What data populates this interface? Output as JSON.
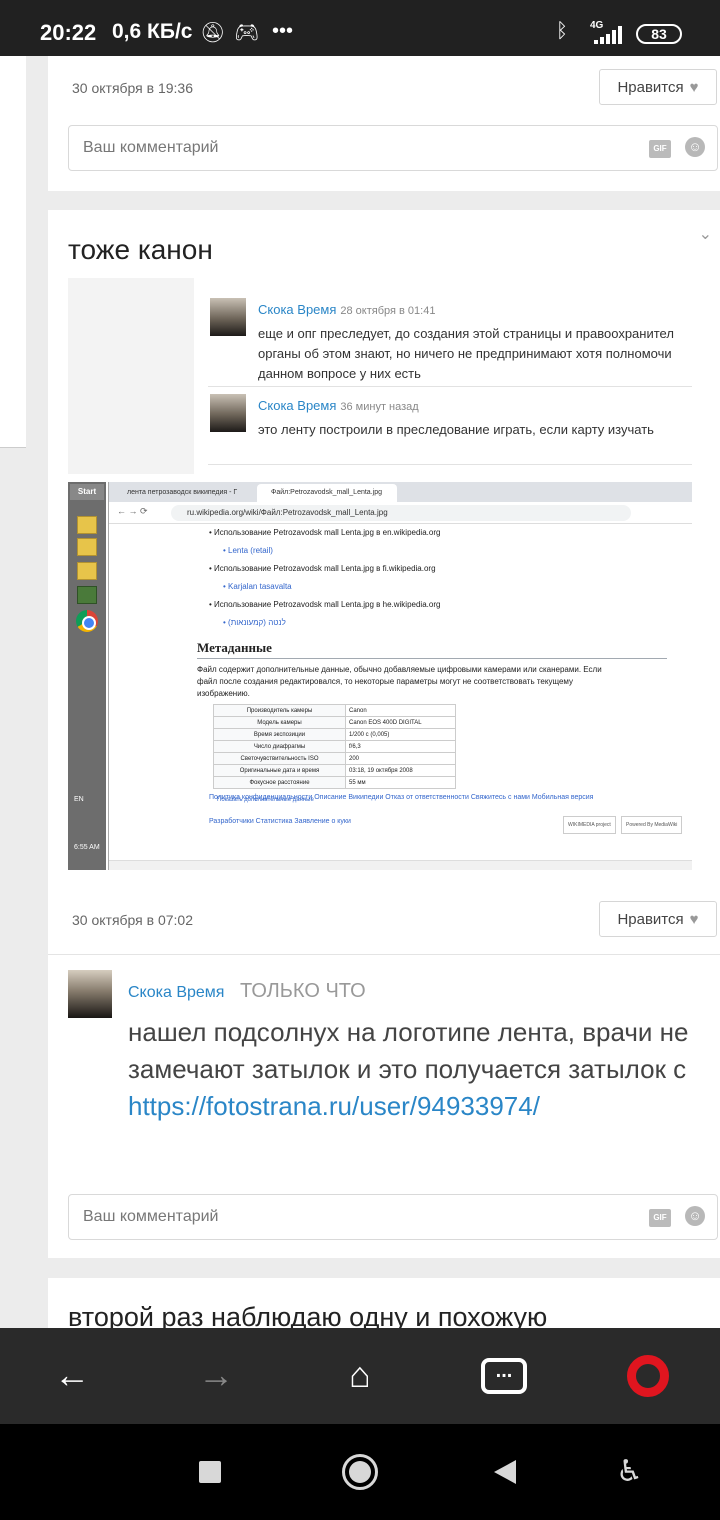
{
  "status_bar": {
    "time": "20:22",
    "speed": "0,6 КБ/с",
    "network": "4G",
    "battery": "83"
  },
  "post1": {
    "date": "30 октября в 19:36",
    "like_label": "Нравится",
    "comment_placeholder": "Ваш комментарий",
    "gif_label": "GIF"
  },
  "post2": {
    "title": "тоже канон",
    "date": "30 октября в 07:02",
    "like_label": "Нравится",
    "embedded": {
      "comments": [
        {
          "name": "Скока Время",
          "time": "28 октября в 01:41",
          "lines": [
            "еще и опг преследует, до создания этой страницы и правоохранител",
            "органы об этом знают, но ничего не предпринимают хотя полномочи",
            "данном вопросе у них есть"
          ]
        },
        {
          "name": "Скока Время",
          "time": "36 минут назад",
          "lines": [
            "это ленту построили в преследование играть, если карту изучать"
          ]
        }
      ],
      "browser": {
        "tab1": "лента петрозаводск википедия - Г",
        "tab2": "Файл:Petrozavodsk_mall_Lenta.jpg",
        "url": "ru.wikipedia.org/wiki/Файл:Petrozavodsk_mall_Lenta.jpg",
        "usage": [
          {
            "text": "Использование Petrozavodsk mall Lenta.jpg в en.wikipedia.org",
            "link": "Lenta (retail)"
          },
          {
            "text": "Использование Petrozavodsk mall Lenta.jpg в fi.wikipedia.org",
            "link": "Karjalan tasavalta"
          },
          {
            "text": "Использование Petrozavodsk mall Lenta.jpg в he.wikipedia.org",
            "link": "לנטה (קמעונאות)"
          }
        ],
        "metadata_heading": "Метаданные",
        "metadata_text": [
          "Файл содержит дополнительные данные, обычно добавляемые цифровыми камерами или сканерами. Если",
          "файл после создания редактировался, то некоторые параметры могут не соответствовать текущему",
          "изображению."
        ],
        "metadata_rows": [
          {
            "k": "Производитель камеры",
            "v": "Canon"
          },
          {
            "k": "Модель камеры",
            "v": "Canon EOS 400D DIGITAL"
          },
          {
            "k": "Время экспозиции",
            "v": "1/200 с (0,005)"
          },
          {
            "k": "Число диафрагмы",
            "v": "f/6,3"
          },
          {
            "k": "Светочувствительность ISO",
            "v": "200"
          },
          {
            "k": "Оригинальные дата и время",
            "v": "03:18, 19 октября 2008"
          },
          {
            "k": "Фокусное расстояние",
            "v": "55 мм"
          }
        ],
        "show_more": "Показать дополнительные данные",
        "footer_row1": "Политика конфиденциальности    Описание Википедии    Отказ от ответственности    Свяжитесь с нами    Мобильная версия",
        "footer_row2": "Разработчики    Статистика    Заявление о куки",
        "badge1": "WIKIMEDIA project",
        "badge2": "Powered By MediaWiki"
      },
      "taskbar": {
        "start": "Start",
        "lang": "EN",
        "clock": "6:55 AM"
      }
    }
  },
  "reply": {
    "name": "Скока Время",
    "time": "только что",
    "text": "нашел подсолнух на логотипе лента, врачи не замечают затылок и это получается затылок с ",
    "link": "https://fotostrana.ru/user/94933974/",
    "comment_placeholder": "Ваш комментарий",
    "gif_label": "GIF"
  },
  "post3": {
    "title": "второй раз наблюдаю одну и похожую"
  }
}
